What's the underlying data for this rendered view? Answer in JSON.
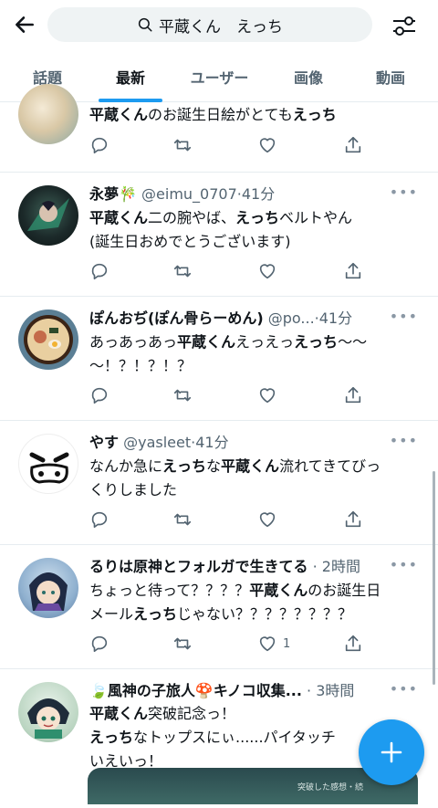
{
  "header": {
    "search_query": "平蔵くん　えっち"
  },
  "tabs": [
    {
      "label": "話題",
      "active": false
    },
    {
      "label": "最新",
      "active": true
    },
    {
      "label": "ユーザー",
      "active": false
    },
    {
      "label": "画像",
      "active": false
    },
    {
      "label": "動画",
      "active": false
    }
  ],
  "colors": {
    "accent": "#1d9bf0",
    "secondary_text": "#536471"
  },
  "tweets": [
    {
      "name": "",
      "handle": "",
      "time": "",
      "text": "平蔵くんのお誕生日絵がとてもえっち",
      "likes": ""
    },
    {
      "name": "永夢🎋",
      "handle": "@eimu_0707",
      "time": "41分",
      "text_line1": "平蔵くん二の腕やば、えっちベルトやん",
      "text_line2": "(誕生日おめでとうございます)",
      "likes": ""
    },
    {
      "name": "ぽんおぢ(ぽん骨らーめん)",
      "handle": "@po...",
      "time": "41分",
      "text_line1": "あっあっあっ平蔵くんえっえっえっち〜〜",
      "text_line2": "〜！？！？！？",
      "likes": ""
    },
    {
      "name": "やす",
      "handle": "@yasleet",
      "time": "41分",
      "text_line1": "なんか急にえっちな平蔵くん流れてきてびっ",
      "text_line2": "くりしました",
      "likes": ""
    },
    {
      "name": "るりは原神とフォルガで生きてる",
      "handle": "",
      "time": "2時間",
      "text_line1": "ちょっと待って？？？？平蔵くんのお誕生日",
      "text_line2": "メールえっちじゃない？？？？？？？？",
      "likes": "1"
    },
    {
      "name": "🍃風神の子旅人🍄キノコ収集...",
      "handle": "",
      "time": "3時間",
      "text_line1": "平蔵くん突破記念っ！",
      "text_line2": "えっちなトップスにぃ......パイタッチ",
      "text_line3": "いえいっ！",
      "likes": "",
      "media_caption": "突破した感想・続"
    }
  ],
  "icons": [
    "back-arrow-icon",
    "search-icon",
    "filter-icon",
    "reply-icon",
    "retweet-icon",
    "like-icon",
    "share-icon",
    "compose-plus-icon",
    "more-icon"
  ]
}
